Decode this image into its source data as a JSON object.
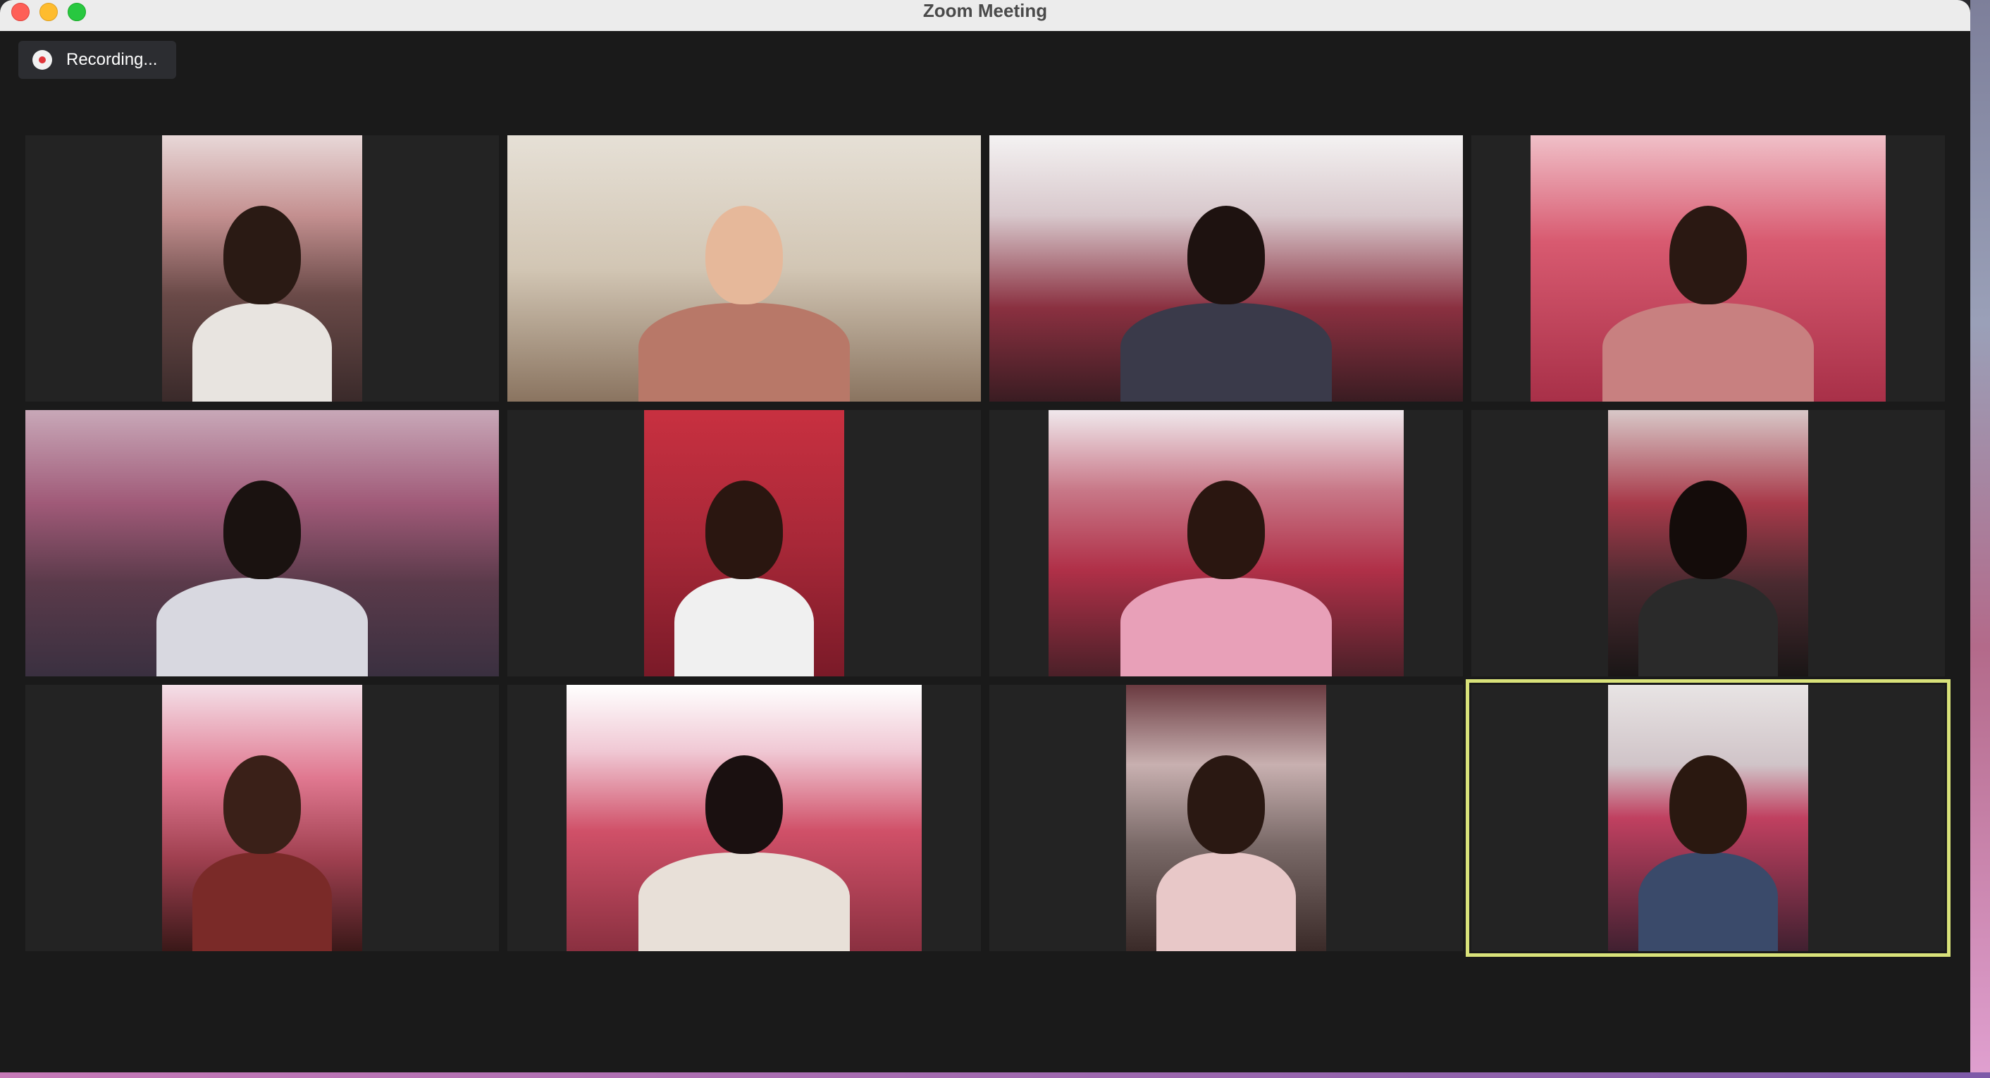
{
  "window": {
    "title": "Zoom Meeting"
  },
  "recording": {
    "label": "Recording...",
    "indicator_color": "#e0353a"
  },
  "gallery": {
    "active_speaker_tile": 12,
    "active_border_color": "#d9e27a",
    "tiles": [
      {
        "id": 1,
        "bg": "linear-gradient(180deg,#e8d8d8 0%,#c49090 30%,#6a4a48 60%,#3a2a2a 100%)",
        "skin": "#2a1a14",
        "shirt": "#e8e4e0"
      },
      {
        "id": 2,
        "bg": "linear-gradient(180deg,#e6e0d6 0%,#d2c6b4 50%,#8a7460 100%)",
        "skin": "#e6b89a",
        "shirt": "#b87868"
      },
      {
        "id": 3,
        "bg": "linear-gradient(180deg,#f4f2f2 0%,#d8c8cc 30%,#8a3040 65%,#3a1c22 100%)",
        "skin": "#1e1210",
        "shirt": "#3a3a4a"
      },
      {
        "id": 4,
        "bg": "linear-gradient(180deg,#f0c0c8 0%,#d85a70 40%,#a83048 100%)",
        "skin": "#2a1812",
        "shirt": "#c88080"
      },
      {
        "id": 5,
        "bg": "linear-gradient(180deg,#c8a8b8 0%,#a05a78 35%,#5a3a4a 65%,#3a3040 100%)",
        "skin": "#1a1210",
        "shirt": "#d8d8e0"
      },
      {
        "id": 6,
        "bg": "linear-gradient(180deg,#c83040 0%,#a82838 50%,#7a1a28 100%)",
        "skin": "#2a1610",
        "shirt": "#f0f0f0"
      },
      {
        "id": 7,
        "bg": "linear-gradient(180deg,#f0e8ec 0%,#c87888 30%,#b03048 60%,#4a2028 100%)",
        "skin": "#2a1610",
        "shirt": "#e8a0b8"
      },
      {
        "id": 8,
        "bg": "linear-gradient(180deg,#d8c8c8 0%,#a83a4a 35%,#4a2a30 65%,#1a1616 100%)",
        "skin": "#140c0a",
        "shirt": "#2a2a2a"
      },
      {
        "id": 9,
        "bg": "linear-gradient(180deg,#f4e0e8 0%,#e07890 35%,#a04050 65%,#3a1818 100%)",
        "skin": "#3a2018",
        "shirt": "#7a2a28"
      },
      {
        "id": 10,
        "bg": "linear-gradient(180deg,#ffffff 0%,#f0c8d4 25%,#d05068 55%,#8a3040 100%)",
        "skin": "#1a1010",
        "shirt": "#e8e0d8"
      },
      {
        "id": 11,
        "bg": "linear-gradient(180deg,#6a3a40 0%,#c8b0b0 30%,#7a6a68 60%,#3a2a28 100%)",
        "skin": "#2a1812",
        "shirt": "#e8c8c8"
      },
      {
        "id": 12,
        "bg": "linear-gradient(180deg,#e8e4e4 0%,#d0c4c8 30%,#c04060 50%,#402030 100%)",
        "skin": "#2a1810",
        "shirt": "#3a4a6a"
      }
    ]
  }
}
